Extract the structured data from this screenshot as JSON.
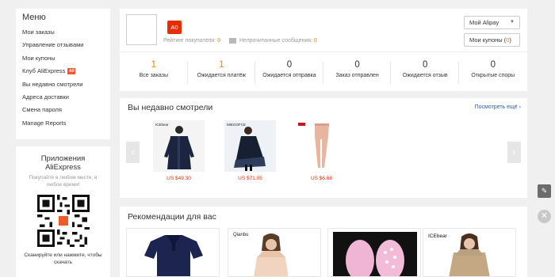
{
  "sidebar": {
    "title": "Меню",
    "items": [
      {
        "label": "Мои заказы"
      },
      {
        "label": "Управление отзывами"
      },
      {
        "label": "Мои купоны"
      },
      {
        "label": "Клуб AliExpress",
        "badge": "A0"
      },
      {
        "label": "Вы недавно смотрели"
      },
      {
        "label": "Адреса доставки"
      },
      {
        "label": "Смена пароля"
      },
      {
        "label": "Manage Reports"
      }
    ]
  },
  "app_panel": {
    "title_line1": "Приложения",
    "title_line2": "AliExpress",
    "subtitle": "Покупайте в любом месте, в любое время!",
    "caption": "Сканируйте или нажмите, чтобы скачать"
  },
  "profile": {
    "badge": "A0",
    "rating_label": "Рейтинг покупателя:",
    "rating_value": "0",
    "unread_label": "Непрочитанные сообщения:",
    "unread_value": "0",
    "alipay_button": "Мой Alipay",
    "coupons_button_label": "Мои купоны (",
    "coupons_count": "0",
    "coupons_button_close": ")"
  },
  "stats": [
    {
      "value": "1",
      "label": "Все заказы",
      "highlight": true
    },
    {
      "value": "1",
      "label": "Ожидается платёж",
      "highlight": true
    },
    {
      "value": "0",
      "label": "Ожидается отправка",
      "highlight": false
    },
    {
      "value": "0",
      "label": "Заказ отправлен",
      "highlight": false
    },
    {
      "value": "0",
      "label": "Ожидается отзыв",
      "highlight": false
    },
    {
      "value": "0",
      "label": "Открытые споры",
      "highlight": false
    }
  ],
  "recent": {
    "title": "Вы недавно смотрели",
    "see_more": "Посмотреть ещё",
    "products": [
      {
        "price": "US $49.30",
        "brand": "ICEbear"
      },
      {
        "price": "US $71.05",
        "brand": "MIEGOFCE"
      },
      {
        "price": "US $6.68",
        "brand": ""
      }
    ]
  },
  "recommendations": {
    "title": "Рекомендации для вас",
    "cards": [
      {
        "brand": ""
      },
      {
        "brand": "Qianbu"
      },
      {
        "brand": ""
      },
      {
        "brand": "ICEbear"
      }
    ]
  },
  "colors": {
    "accent": "#f08200",
    "price": "#e62e04",
    "link": "#2e5ca5"
  }
}
